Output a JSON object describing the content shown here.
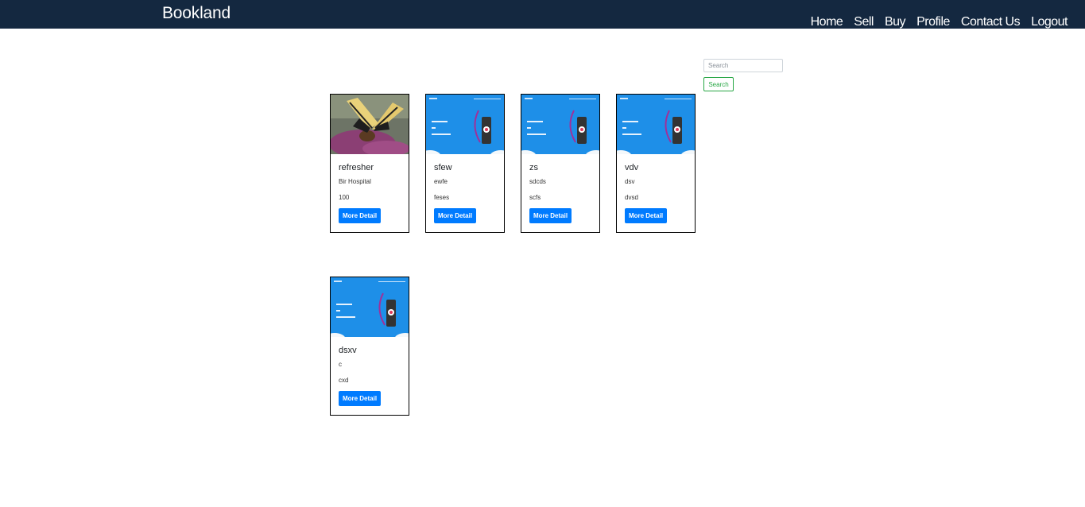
{
  "header": {
    "brand": "Bookland",
    "nav": [
      "Home",
      "Sell",
      "Buy",
      "Profile",
      "Contact Us",
      "Logout"
    ]
  },
  "search": {
    "placeholder": "Search",
    "button_label": "Search"
  },
  "cards": [
    {
      "title": "refresher",
      "author": "Bir Hospital",
      "price": "100",
      "button_label": "More Detail",
      "image": "butterfly-photo"
    },
    {
      "title": "sfew",
      "author": "ewfe",
      "price": "feses",
      "button_label": "More Detail",
      "image": "website-screenshot"
    },
    {
      "title": "zs",
      "author": "sdcds",
      "price": "scfs",
      "button_label": "More Detail",
      "image": "website-screenshot"
    },
    {
      "title": "vdv",
      "author": "dsv",
      "price": "dvsd",
      "button_label": "More Detail",
      "image": "website-screenshot"
    },
    {
      "title": "dsxv",
      "author": "c",
      "price": "cxd",
      "button_label": "More Detail",
      "image": "website-screenshot"
    }
  ],
  "colors": {
    "navbar": "#142840",
    "detail_button": "#007bff",
    "search_button": "#28a745"
  }
}
